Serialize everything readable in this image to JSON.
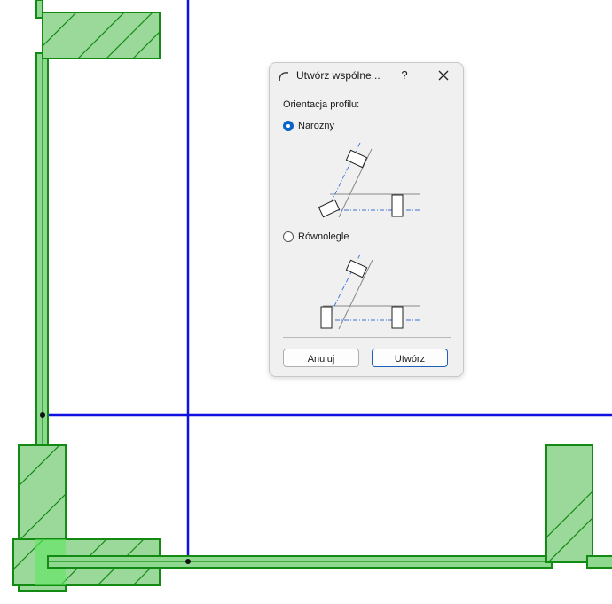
{
  "dialog": {
    "title": "Utwórz wspólne...",
    "help_label": "?",
    "section_label": "Orientacja profilu:",
    "options": [
      {
        "label": "Narożny",
        "selected": true
      },
      {
        "label": "Równolegle",
        "selected": false
      }
    ],
    "cancel_label": "Anuluj",
    "create_label": "Utwórz"
  },
  "colors": {
    "wall_fill": "#7ed07e",
    "wall_stroke": "#138a13",
    "axis_line": "#1010e0",
    "accent": "#0a64c8"
  }
}
